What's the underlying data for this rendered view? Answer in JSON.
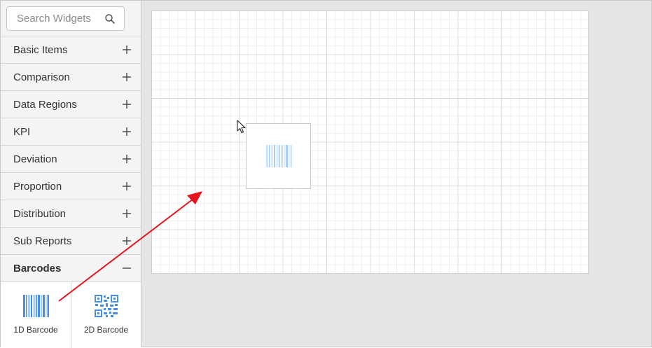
{
  "search": {
    "placeholder": "Search Widgets",
    "icon": "search-icon"
  },
  "categories": [
    {
      "label": "Basic Items",
      "state": "collapsed",
      "icon": "plus-icon"
    },
    {
      "label": "Comparison",
      "state": "collapsed",
      "icon": "plus-icon"
    },
    {
      "label": "Data Regions",
      "state": "collapsed",
      "icon": "plus-icon"
    },
    {
      "label": "KPI",
      "state": "collapsed",
      "icon": "plus-icon"
    },
    {
      "label": "Deviation",
      "state": "collapsed",
      "icon": "plus-icon"
    },
    {
      "label": "Proportion",
      "state": "collapsed",
      "icon": "plus-icon"
    },
    {
      "label": "Distribution",
      "state": "collapsed",
      "icon": "plus-icon"
    },
    {
      "label": "Sub Reports",
      "state": "collapsed",
      "icon": "plus-icon"
    },
    {
      "label": "Barcodes",
      "state": "expanded",
      "icon": "minus-icon"
    }
  ],
  "barcode_widgets": [
    {
      "label": "1D Barcode",
      "icon": "barcode-1d-icon"
    },
    {
      "label": "2D Barcode",
      "icon": "qr-code-icon"
    }
  ],
  "canvas": {
    "dragging_widget": "1D Barcode"
  },
  "colors": {
    "accent_blue": "#4a90e2",
    "light_blue": "#a9cdf5",
    "annotation_red": "#e8141c",
    "sidebar_bg": "#f4f4f4",
    "canvas_bg": "#e6e6e6"
  }
}
